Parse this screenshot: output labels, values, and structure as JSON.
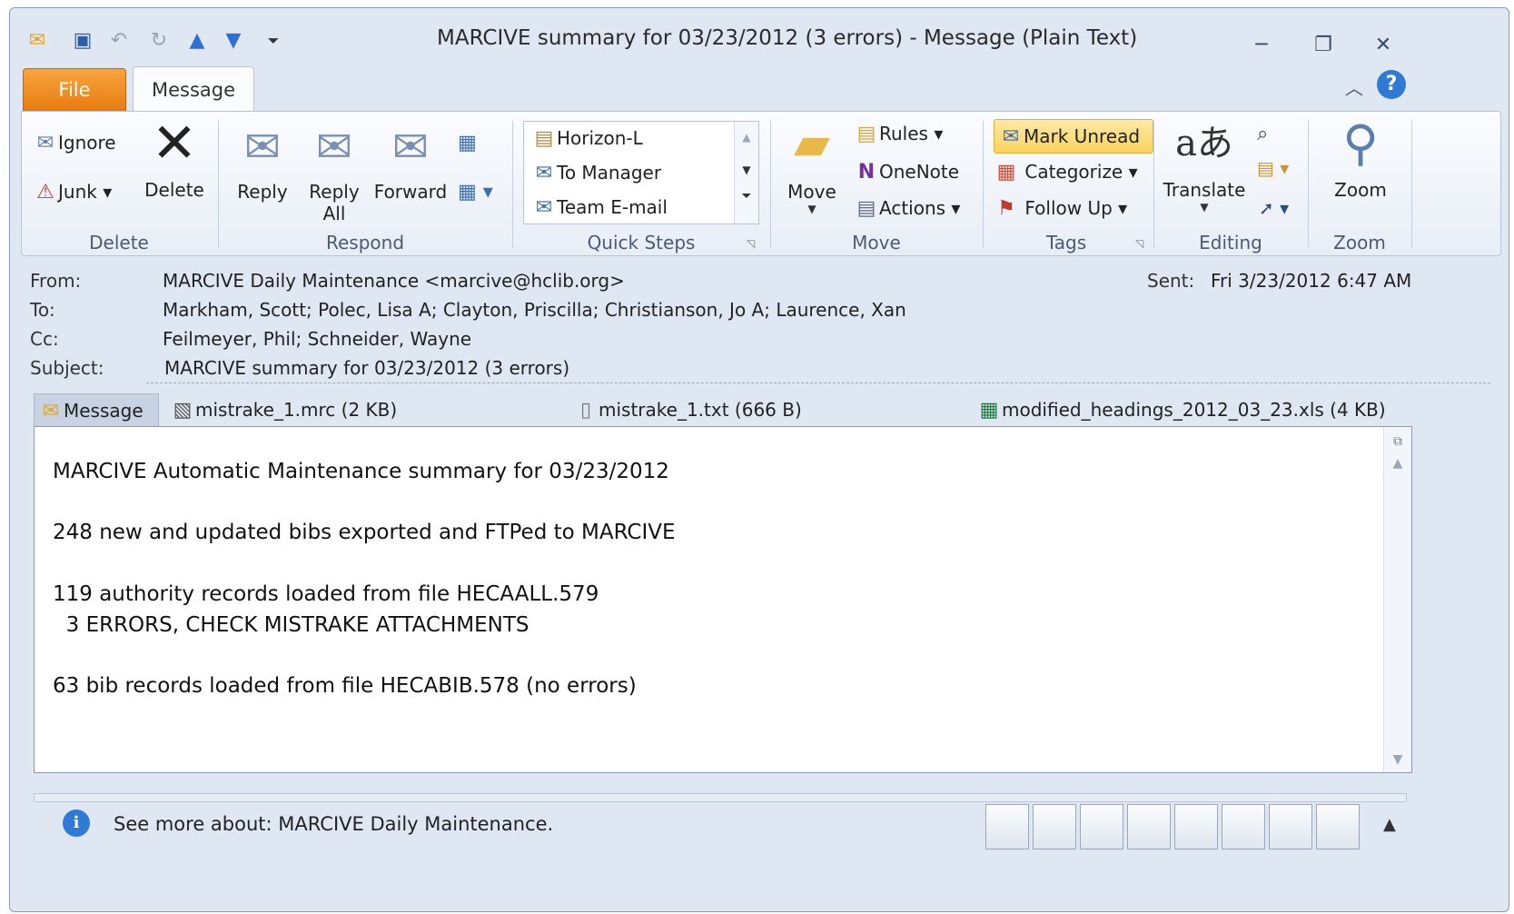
{
  "window": {
    "title": "MARCIVE summary for 03/23/2012 (3 errors)  -  Message (Plain Text)",
    "controls": [
      "minimize",
      "restore",
      "close"
    ]
  },
  "qat": {
    "icons": [
      "mail-icon",
      "save-icon",
      "undo-icon",
      "redo-icon",
      "up-arrow-icon",
      "down-arrow-icon",
      "customize-icon"
    ]
  },
  "tabs": {
    "file": "File",
    "message": "Message"
  },
  "ribbon": {
    "delete_group": {
      "label": "Delete",
      "ignore": "Ignore",
      "junk": "Junk",
      "delete": "Delete"
    },
    "respond_group": {
      "label": "Respond",
      "reply": "Reply",
      "reply_all_1": "Reply",
      "reply_all_2": "All",
      "forward": "Forward"
    },
    "quicksteps_group": {
      "label": "Quick Steps",
      "items": [
        "Horizon-L",
        "To Manager",
        "Team E-mail"
      ]
    },
    "move_group": {
      "label": "Move",
      "move": "Move",
      "rules": "Rules",
      "onenote": "OneNote",
      "actions": "Actions"
    },
    "tags_group": {
      "label": "Tags",
      "mark_unread": "Mark Unread",
      "categorize": "Categorize",
      "follow_up": "Follow Up"
    },
    "editing_group": {
      "label": "Editing",
      "translate": "Translate"
    },
    "zoom_group": {
      "label": "Zoom",
      "zoom": "Zoom"
    }
  },
  "header": {
    "from_label": "From:",
    "from_value": "MARCIVE Daily Maintenance <marcive@hclib.org>",
    "sent_label": "Sent:",
    "sent_value": "Fri 3/23/2012 6:47 AM",
    "to_label": "To:",
    "to_value": "Markham, Scott; Polec, Lisa A; Clayton, Priscilla; Christianson, Jo A; Laurence, Xan",
    "cc_label": "Cc:",
    "cc_value": "Feilmeyer, Phil; Schneider, Wayne",
    "subject_label": "Subject:",
    "subject_value": "MARCIVE summary for 03/23/2012 (3 errors)"
  },
  "attachments": {
    "message_tab": "Message",
    "items": [
      "mistrake_1.mrc (2 KB)",
      "mistrake_1.txt (666 B)",
      "modified_headings_2012_03_23.xls (4 KB)"
    ]
  },
  "body": {
    "lines": [
      "MARCIVE Automatic Maintenance summary for 03/23/2012",
      "248 new and updated bibs exported and FTPed to MARCIVE",
      "119 authority records loaded from file HECAALL.579",
      "  3 ERRORS, CHECK MISTRAKE ATTACHMENTS",
      "63 bib records loaded from file HECABIB.578 (no errors)"
    ]
  },
  "people_pane": {
    "text": "See more about: MARCIVE Daily Maintenance."
  }
}
